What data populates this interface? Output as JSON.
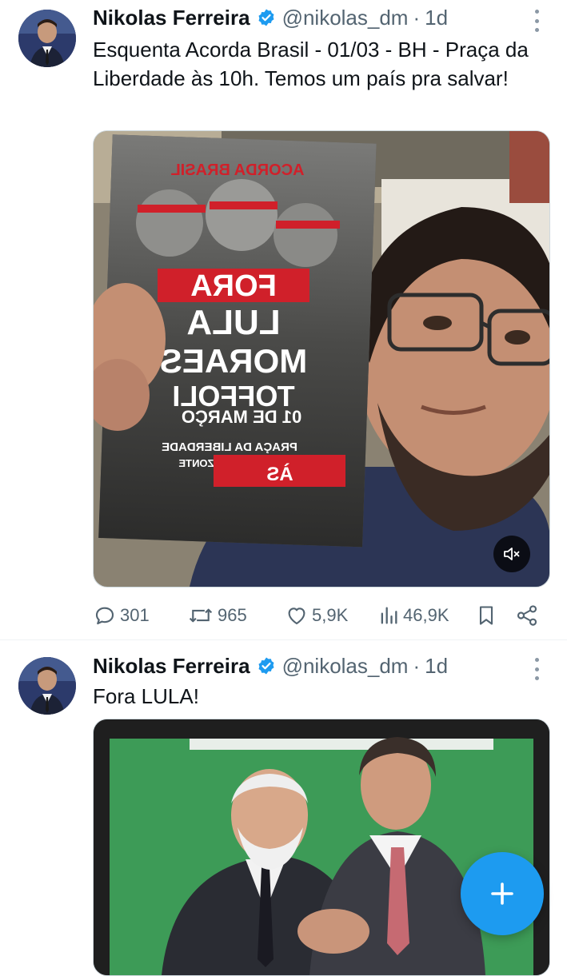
{
  "tweets": [
    {
      "author_name": "Nikolas Ferreira",
      "handle": "@nikolas_dm",
      "separator": "·",
      "time": "1d",
      "text": "Esquenta Acorda Brasil - 01/03 - BH - Praça da Liberdade às 10h. Temos um país pra salvar!",
      "media_type": "video",
      "media_flyer_text": [
        "ACORDA BRASIL",
        "FORA",
        "LULA",
        "MORAES",
        "TOFFOLI",
        "01 DE MARÇO",
        "PRAÇA DA LIBERDADE",
        "– BELO HORIZONTE",
        "ÀS"
      ],
      "stats": {
        "replies": "301",
        "reposts": "965",
        "likes": "5,9K",
        "views": "46,9K"
      }
    },
    {
      "author_name": "Nikolas Ferreira",
      "handle": "@nikolas_dm",
      "separator": "·",
      "time": "1d",
      "text": "Fora LULA!",
      "media_type": "photo"
    }
  ],
  "icons": {
    "verified": "verified-badge-icon",
    "more": "more-vertical-icon",
    "reply": "reply-icon",
    "repost": "repost-icon",
    "like": "heart-icon",
    "views": "views-icon",
    "bookmark": "bookmark-icon",
    "share": "share-icon",
    "mute": "volume-muted-icon",
    "compose": "plus-icon"
  },
  "colors": {
    "accent": "#1d9bf0",
    "text_primary": "#0f1419",
    "text_secondary": "#536471",
    "flyer_red": "#d0202a"
  }
}
